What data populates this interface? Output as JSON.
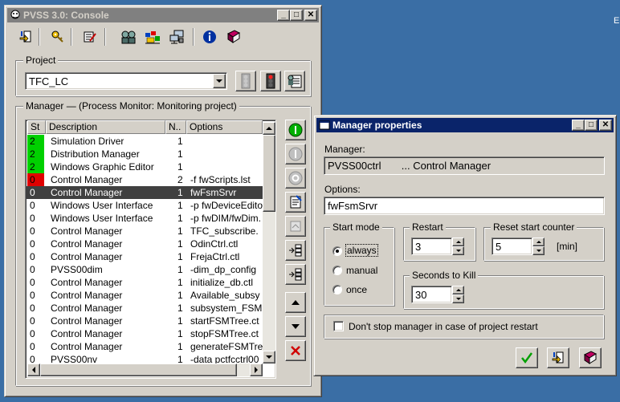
{
  "desktop": {
    "corner_text": "E"
  },
  "console": {
    "title": "PVSS 3.0: Console",
    "toolbar": [
      "exit-icon",
      "key-icon",
      "edit-icon",
      "users-icon",
      "gedi-icon",
      "network-icon",
      "info-icon",
      "help-book-icon"
    ],
    "project": {
      "label": "Project",
      "selected": "TFC_LC"
    },
    "manager": {
      "label": "Manager",
      "status": "(Process Monitor: Monitoring project)",
      "columns": [
        "St",
        "Description",
        "N..",
        "Options"
      ],
      "rows": [
        {
          "st": "2",
          "status": "green",
          "desc": "Simulation Driver",
          "num": "1",
          "opt": ""
        },
        {
          "st": "2",
          "status": "green",
          "desc": "Distribution Manager",
          "num": "1",
          "opt": ""
        },
        {
          "st": "2",
          "status": "green",
          "desc": "Windows Graphic Editor",
          "num": "1",
          "opt": ""
        },
        {
          "st": "0",
          "status": "red",
          "desc": "Control Manager",
          "num": "2",
          "opt": "-f fwScripts.lst"
        },
        {
          "st": "0",
          "status": "selected",
          "desc": "Control Manager",
          "num": "1",
          "opt": "fwFsmSrvr"
        },
        {
          "st": "0",
          "status": "",
          "desc": "Windows User Interface",
          "num": "1",
          "opt": "-p fwDeviceEdito"
        },
        {
          "st": "0",
          "status": "",
          "desc": "Windows User Interface",
          "num": "1",
          "opt": "-p fwDIM/fwDim."
        },
        {
          "st": "0",
          "status": "",
          "desc": "Control Manager",
          "num": "1",
          "opt": "TFC_subscribe."
        },
        {
          "st": "0",
          "status": "",
          "desc": "Control Manager",
          "num": "1",
          "opt": "OdinCtrl.ctl"
        },
        {
          "st": "0",
          "status": "",
          "desc": "Control Manager",
          "num": "1",
          "opt": "FrejaCtrl.ctl"
        },
        {
          "st": "0",
          "status": "",
          "desc": "PVSS00dim",
          "num": "1",
          "opt": "-dim_dp_config"
        },
        {
          "st": "0",
          "status": "",
          "desc": "Control Manager",
          "num": "1",
          "opt": "initialize_db.ctl"
        },
        {
          "st": "0",
          "status": "",
          "desc": "Control Manager",
          "num": "1",
          "opt": "Available_subsy"
        },
        {
          "st": "0",
          "status": "",
          "desc": "Control Manager",
          "num": "1",
          "opt": "subsystem_FSM"
        },
        {
          "st": "0",
          "status": "",
          "desc": "Control Manager",
          "num": "1",
          "opt": "startFSMTree.ct"
        },
        {
          "st": "0",
          "status": "",
          "desc": "Control Manager",
          "num": "1",
          "opt": "stopFSMTree.ct"
        },
        {
          "st": "0",
          "status": "",
          "desc": "Control Manager",
          "num": "1",
          "opt": "generateFSMTre"
        },
        {
          "st": "0",
          "status": "",
          "desc": "PVSS00nv",
          "num": "1",
          "opt": "-data pctfcctrl00"
        }
      ]
    }
  },
  "props": {
    "title": "Manager properties",
    "manager_label": "Manager:",
    "manager_value": "PVSS00ctrl       ... Control Manager",
    "options_label": "Options:",
    "options_value": "fwFsmSrvr",
    "start_mode": {
      "label": "Start mode",
      "options": [
        "always",
        "manual",
        "once"
      ],
      "selected": "always"
    },
    "restart": {
      "label": "Restart",
      "value": "3"
    },
    "reset_counter": {
      "label": "Reset start counter",
      "value": "5",
      "unit": "[min]"
    },
    "seconds_to_kill": {
      "label": "Seconds to Kill",
      "value": "30"
    },
    "dont_stop_label": "Don't stop manager in case of project restart",
    "dont_stop_checked": false
  }
}
